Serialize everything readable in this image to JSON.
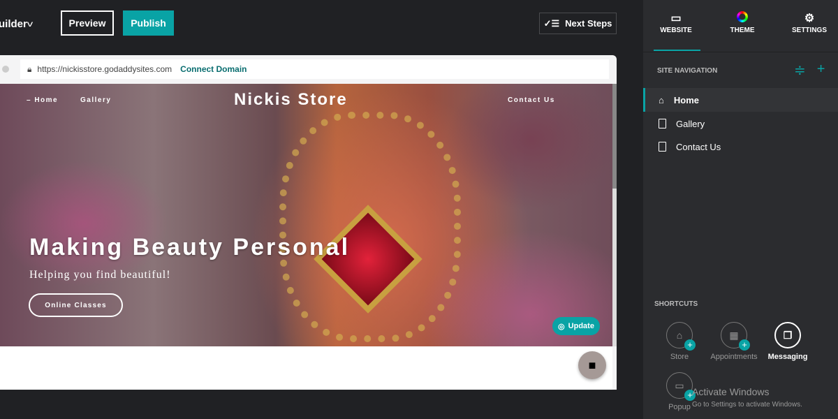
{
  "topbar": {
    "builder_label": "uilder",
    "preview": "Preview",
    "publish": "Publish",
    "next_steps": "Next Steps"
  },
  "browser": {
    "url": "https://nickisstore.godaddysites.com",
    "connect_domain": "Connect Domain"
  },
  "site": {
    "nav": [
      "– Home",
      "Gallery",
      "Contact Us"
    ],
    "title": "Nickis Store",
    "headline": "Making Beauty Personal",
    "subheadline": "Helping you find beautiful!",
    "cta": "Online Classes",
    "update": "Update"
  },
  "panel": {
    "tabs": [
      {
        "label": "WEBSITE",
        "icon": "browser-window-icon"
      },
      {
        "label": "THEME",
        "icon": "color-ring-icon"
      },
      {
        "label": "SETTINGS",
        "icon": "gear-icon"
      }
    ],
    "site_navigation": "SITE NAVIGATION",
    "pages": [
      {
        "label": "Home",
        "icon": "home-icon"
      },
      {
        "label": "Gallery",
        "icon": "page-icon"
      },
      {
        "label": "Contact Us",
        "icon": "page-icon"
      }
    ],
    "shortcuts_label": "SHORTCUTS",
    "shortcuts": [
      {
        "label": "Store"
      },
      {
        "label": "Appointments"
      },
      {
        "label": "Messaging"
      },
      {
        "label": "Popup"
      }
    ]
  },
  "watermark": {
    "title": "Activate Windows",
    "subtitle": "Go to Settings to activate Windows."
  },
  "colors": {
    "accent": "#09a3a5",
    "background": "#202124",
    "panel": "#2b2c2f"
  }
}
